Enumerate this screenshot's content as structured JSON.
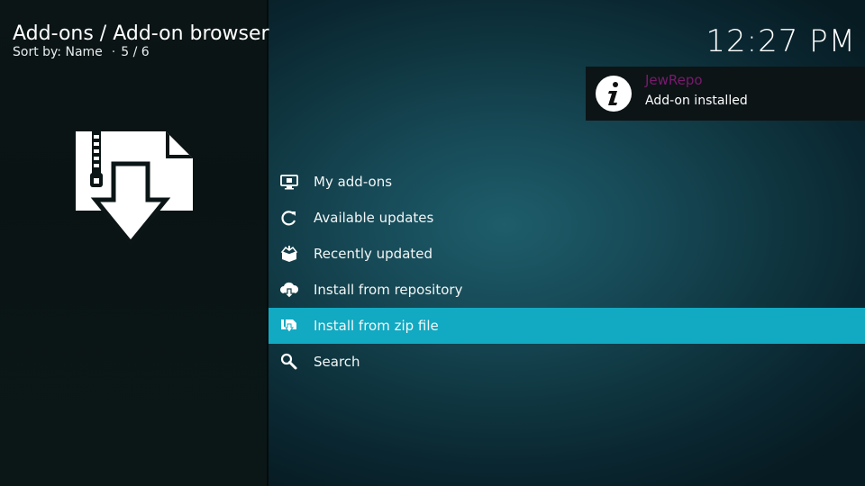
{
  "header": {
    "title": "Add-ons / Add-on browser",
    "sort_label": "Sort by: Name",
    "separator": "·",
    "position": "5 / 6"
  },
  "clock": "12:27 PM",
  "notification": {
    "title": "JewRepo",
    "message": "Add-on installed",
    "icon": "info-icon"
  },
  "menu": {
    "items": [
      {
        "label": "My add-ons",
        "icon": "monitor-icon",
        "selected": false
      },
      {
        "label": "Available updates",
        "icon": "refresh-icon",
        "selected": false
      },
      {
        "label": "Recently updated",
        "icon": "open-box-icon",
        "selected": false
      },
      {
        "label": "Install from repository",
        "icon": "cloud-download-icon",
        "selected": false
      },
      {
        "label": "Install from zip file",
        "icon": "zip-file-icon",
        "selected": true
      },
      {
        "label": "Search",
        "icon": "search-icon",
        "selected": false
      }
    ]
  },
  "preview_icon": "zip-download-icon",
  "colors": {
    "highlight": "#12a9c2",
    "notification_title": "#7a1a6e",
    "background": "#0f3640"
  }
}
